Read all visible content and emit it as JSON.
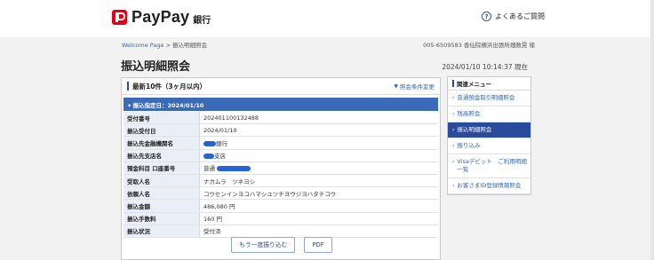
{
  "header": {
    "brand": "PayPay",
    "brand_suffix": "銀行",
    "faq_label": "よくあるご質問",
    "faq_icon": "?"
  },
  "breadcrumb": {
    "home": "Welcome Page",
    "separator": " > ",
    "current": "振込明細照会"
  },
  "account_info": "005-6509583 香仙院横浜出張所畑数晃 様",
  "page_title": "振込明細照会",
  "timestamp": "2024/01/10 10:14:37 現在",
  "panel": {
    "title": "最新10件（3ヶ月以内）",
    "change_link": "照会条件変更",
    "date_header": "▾ 振込指定日：2024/01/10",
    "rows": [
      {
        "label": "受付番号",
        "value": "202401100132488"
      },
      {
        "label": "振込受付日",
        "value": "2024/01/10"
      },
      {
        "label": "振込先金融機関名",
        "value": "銀行"
      },
      {
        "label": "振込先支店名",
        "value": "支店"
      },
      {
        "label": "預金科目 口座番号",
        "value": "普通"
      },
      {
        "label": "受取人名",
        "value": "ナカムラ　ツネヨシ"
      },
      {
        "label": "依頼人名",
        "value": "コウセンインヨコハマシユツチヨウジヨハタチコウ"
      },
      {
        "label": "振込金額",
        "value": "486,080 円"
      },
      {
        "label": "振込手数料",
        "value": "160 円"
      },
      {
        "label": "振込状況",
        "value": "受付済"
      }
    ],
    "buttons": {
      "retransfer": "もう一度振り込む",
      "pdf": "PDF"
    }
  },
  "side_menu": {
    "title": "関連メニュー",
    "items": [
      {
        "label": "普通預金取引明細照会",
        "active": false
      },
      {
        "label": "残高照会",
        "active": false
      },
      {
        "label": "振込明細照会",
        "active": true
      },
      {
        "label": "振り込み",
        "active": false
      },
      {
        "label": "Visaデビット　ご利用明細一覧",
        "active": false
      },
      {
        "label": "お客さまID登録情報照会",
        "active": false
      }
    ]
  },
  "colors": {
    "brand_red": "#e60012",
    "primary_blue": "#2a4a9c",
    "date_bar_blue": "#3a6ab8"
  }
}
